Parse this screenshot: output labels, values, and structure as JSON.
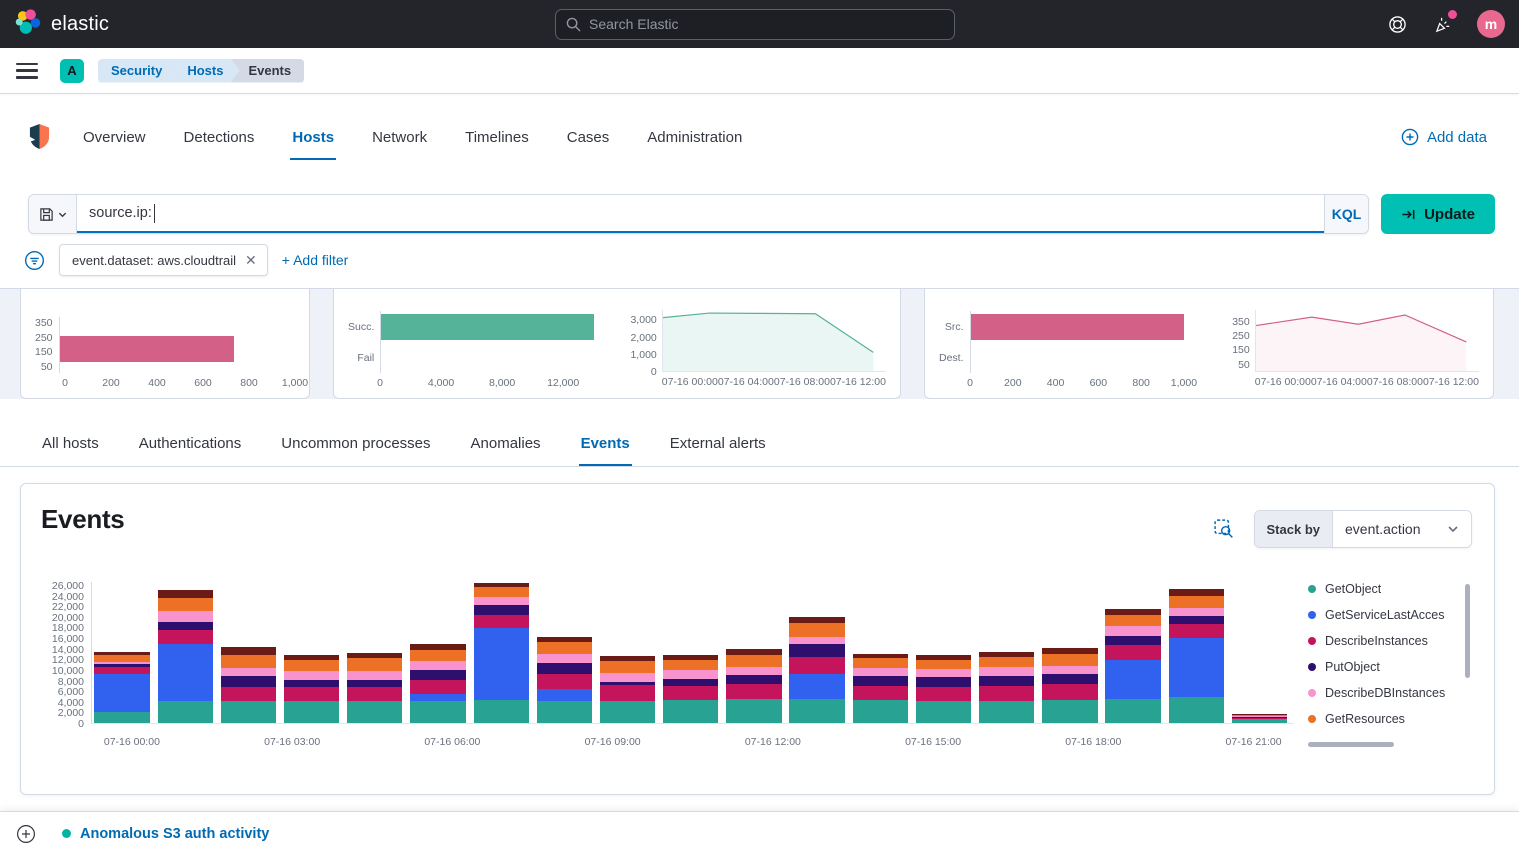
{
  "topbar": {
    "brand": "elastic",
    "search_placeholder": "Search Elastic",
    "avatar_initial": "m"
  },
  "header": {
    "app_badge": "A",
    "breadcrumbs": [
      "Security",
      "Hosts",
      "Events"
    ]
  },
  "nav": {
    "tabs": [
      {
        "label": "Overview",
        "active": false
      },
      {
        "label": "Detections",
        "active": false
      },
      {
        "label": "Hosts",
        "active": true
      },
      {
        "label": "Network",
        "active": false
      },
      {
        "label": "Timelines",
        "active": false
      },
      {
        "label": "Cases",
        "active": false
      },
      {
        "label": "Administration",
        "active": false
      }
    ],
    "add_data": "Add data"
  },
  "querybar": {
    "query": "source.ip: ",
    "kql": "KQL",
    "update": "Update"
  },
  "filterbar": {
    "filter_pill": "event.dataset: aws.cloudtrail",
    "add_filter": "+ Add filter"
  },
  "host_tabs": {
    "tabs": [
      {
        "label": "All hosts",
        "active": false
      },
      {
        "label": "Authentications",
        "active": false
      },
      {
        "label": "Uncommon processes",
        "active": false
      },
      {
        "label": "Anomalies",
        "active": false
      },
      {
        "label": "Events",
        "active": true
      },
      {
        "label": "External alerts",
        "active": false
      }
    ]
  },
  "events_panel": {
    "title": "Events",
    "stack_by_label": "Stack by",
    "stack_by_value": "event.action"
  },
  "timeline_bar": {
    "event_label": "Anomalous S3 auth activity",
    "dot_color": "#00B3A4"
  },
  "colors": {
    "accent_blue": "#006bb4",
    "teal": "#00BFB3",
    "pink": "#D36086",
    "green": "#54B399"
  },
  "chart_data": [
    {
      "id": "uncommon-kpi",
      "type": "bar",
      "variant": "ylabels",
      "color": "#D36086",
      "ylabels": [
        "350",
        "250",
        "150",
        "50"
      ],
      "value": 740,
      "xmax": 1000,
      "xticks": [
        {
          "v": 0,
          "l": "0"
        },
        {
          "v": 200,
          "l": "200"
        },
        {
          "v": 400,
          "l": "400"
        },
        {
          "v": 600,
          "l": "600"
        },
        {
          "v": 800,
          "l": "800"
        },
        {
          "v": 1000,
          "l": "1,000"
        }
      ]
    },
    {
      "id": "auth-bar",
      "type": "bar",
      "color": "#54B399",
      "rows": [
        {
          "label": "Succ.",
          "value": 14000
        },
        {
          "label": "Fail",
          "value": 0
        }
      ],
      "xmax": 14400,
      "xticks": [
        {
          "v": 0,
          "l": "0"
        },
        {
          "v": 4000,
          "l": "4,000"
        },
        {
          "v": 8000,
          "l": "8,000"
        },
        {
          "v": 12000,
          "l": "12,000"
        }
      ]
    },
    {
      "id": "auth-area",
      "type": "area",
      "color": "#54B399",
      "fill": "rgba(84,179,153,0.12)",
      "ymax": 3600,
      "yticks": [
        {
          "v": 0,
          "l": "0"
        },
        {
          "v": 1000,
          "l": "1,000"
        },
        {
          "v": 2000,
          "l": "2,000"
        },
        {
          "v": 3000,
          "l": "3,000"
        }
      ],
      "points": [
        {
          "x": 0,
          "y": 3150
        },
        {
          "x": 2.5,
          "y": 3420
        },
        {
          "x": 5,
          "y": 3400
        },
        {
          "x": 8.2,
          "y": 3380
        },
        {
          "x": 11.3,
          "y": 1100
        }
      ],
      "xmax": 12,
      "xlabels": [
        "07-16 00:00",
        "07-16 04:00",
        "07-16 08:00",
        "07-16 12:00"
      ]
    },
    {
      "id": "ip-bar",
      "type": "bar",
      "color": "#D36086",
      "rows": [
        {
          "label": "Src.",
          "value": 1000
        },
        {
          "label": "Dest.",
          "value": 0
        }
      ],
      "xmax": 1060,
      "xticks": [
        {
          "v": 0,
          "l": "0"
        },
        {
          "v": 200,
          "l": "200"
        },
        {
          "v": 400,
          "l": "400"
        },
        {
          "v": 600,
          "l": "600"
        },
        {
          "v": 800,
          "l": "800"
        },
        {
          "v": 1000,
          "l": "1,000"
        }
      ]
    },
    {
      "id": "ip-line",
      "type": "area",
      "color": "#D36086",
      "fill": "rgba(211,96,134,0.07)",
      "ymax": 430,
      "yticks": [
        {
          "v": 50,
          "l": "50"
        },
        {
          "v": 150,
          "l": "150"
        },
        {
          "v": 250,
          "l": "250"
        },
        {
          "v": 350,
          "l": "350"
        }
      ],
      "points": [
        {
          "x": 0,
          "y": 320
        },
        {
          "x": 3,
          "y": 380
        },
        {
          "x": 5.5,
          "y": 330
        },
        {
          "x": 8,
          "y": 395
        },
        {
          "x": 11.3,
          "y": 205
        }
      ],
      "xmax": 12,
      "xlabels": [
        "07-16 00:00",
        "07-16 04:00",
        "07-16 08:00",
        "07-16 12:00"
      ]
    },
    {
      "id": "events-stacked",
      "type": "stacked-bar",
      "ymax": 26000,
      "yticks": [
        "0",
        "2,000",
        "4,000",
        "6,000",
        "8,000",
        "10,000",
        "12,000",
        "14,000",
        "16,000",
        "18,000",
        "20,000",
        "22,000",
        "24,000",
        "26,000"
      ],
      "xlabels": [
        "07-16 00:00",
        "07-16 03:00",
        "07-16 06:00",
        "07-16 09:00",
        "07-16 12:00",
        "07-16 15:00",
        "07-16 18:00",
        "07-16 21:00"
      ],
      "series": [
        {
          "name": "GetObject",
          "color": "#28A293"
        },
        {
          "name": "GetServiceLastAcces",
          "color": "#3062EF"
        },
        {
          "name": "DescribeInstances",
          "color": "#C4145C"
        },
        {
          "name": "PutObject",
          "color": "#2F0F6D"
        },
        {
          "name": "DescribeDBInstances",
          "color": "#F893CE"
        },
        {
          "name": "GetResources",
          "color": "#EC7026"
        },
        {
          "name": "",
          "color": "#6B1B16"
        }
      ],
      "bars": [
        [
          2000,
          7000,
          1400,
          400,
          500,
          1200,
          600
        ],
        [
          4000,
          10500,
          2600,
          1500,
          2000,
          2400,
          1500
        ],
        [
          4000,
          0,
          2600,
          2000,
          1600,
          2400,
          1400
        ],
        [
          4000,
          0,
          2600,
          1400,
          1600,
          2000,
          1000
        ],
        [
          4000,
          0,
          2600,
          1400,
          1500,
          2400,
          1100
        ],
        [
          4000,
          1400,
          2600,
          1800,
          1700,
          2000,
          1000
        ],
        [
          4200,
          13300,
          2500,
          1800,
          1500,
          1700,
          800
        ],
        [
          4000,
          2200,
          2800,
          2000,
          1800,
          2200,
          800
        ],
        [
          4000,
          0,
          3000,
          500,
          1800,
          2200,
          900
        ],
        [
          4200,
          0,
          2600,
          1400,
          1500,
          2000,
          900
        ],
        [
          4400,
          0,
          2800,
          1600,
          1600,
          2200,
          1000
        ],
        [
          4500,
          4600,
          3000,
          2400,
          1400,
          2500,
          1100
        ],
        [
          4200,
          0,
          2700,
          1700,
          1500,
          1800,
          900
        ],
        [
          4000,
          0,
          2600,
          1800,
          1600,
          1700,
          800
        ],
        [
          4100,
          0,
          2700,
          1800,
          1800,
          1800,
          800
        ],
        [
          4200,
          0,
          3000,
          1800,
          1500,
          2200,
          1200
        ],
        [
          4500,
          7200,
          2600,
          1800,
          1700,
          2100,
          1100
        ],
        [
          4800,
          10800,
          2600,
          1500,
          1500,
          2300,
          1300
        ],
        [
          700,
          0,
          300,
          150,
          100,
          250,
          100
        ]
      ]
    }
  ]
}
